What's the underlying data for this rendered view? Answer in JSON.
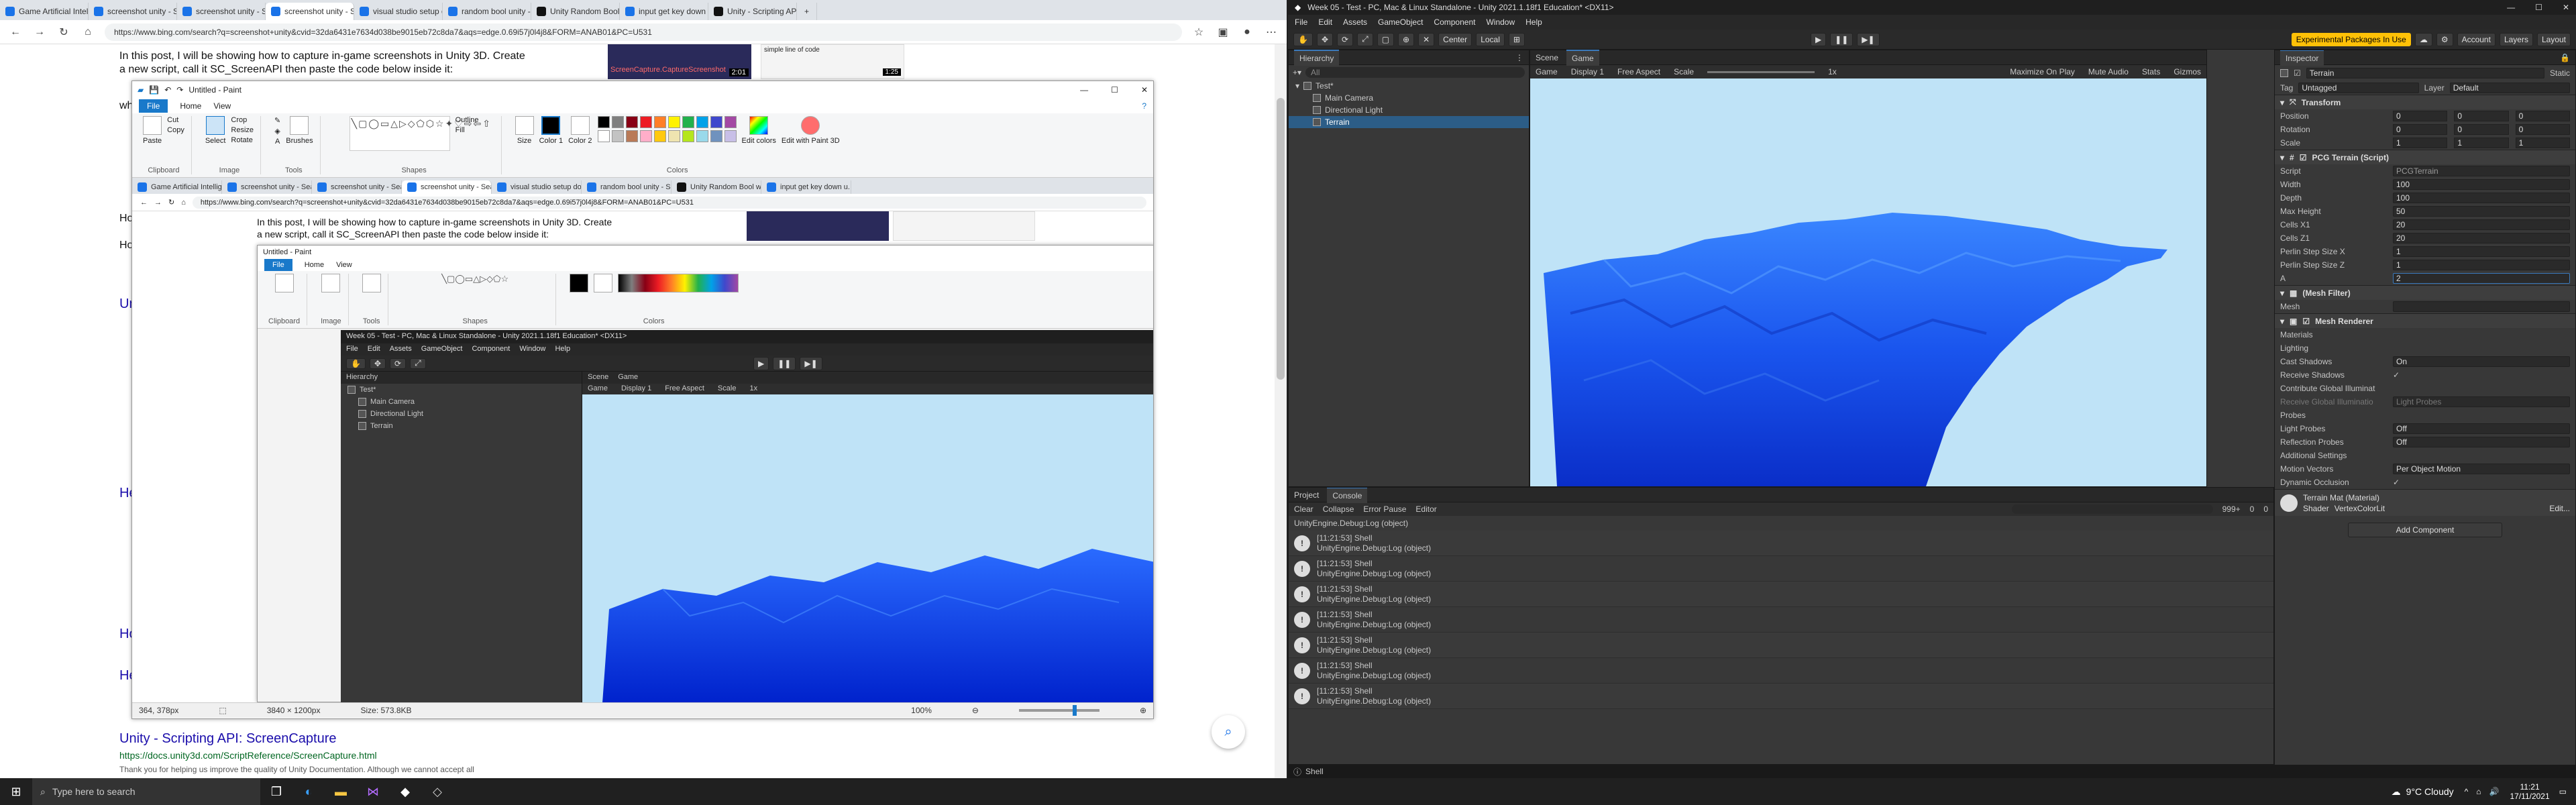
{
  "browser": {
    "tabs": [
      {
        "label": "Game Artificial Intellig..."
      },
      {
        "label": "screenshot unity - Sea..."
      },
      {
        "label": "screenshot unity - Sea..."
      },
      {
        "label": "screenshot unity - Sea..."
      },
      {
        "label": "visual studio setup do..."
      },
      {
        "label": "random bool unity - S..."
      },
      {
        "label": "Unity Random Bool w..."
      },
      {
        "label": "input get key down u..."
      },
      {
        "label": "Unity - Scripting API:..."
      }
    ],
    "url": "https://www.bing.com/search?q=screenshot+unity&cvid=32da6431e7634d038be9015eb72c8da7&aqs=edge.0.69i57j0l4j8&FORM=ANAB01&PC=U531",
    "page": {
      "intro_line1": "In this post, I will be showing how to capture in-game screenshots in Unity 3D. Create",
      "intro_line2": "a new script, call it SC_ScreenAPI then paste the code below inside it:",
      "result_title": "Unity - Scripting API: ScreenCapture",
      "result_url": "https://docs.unity3d.com/ScriptReference/ScreenCapture.html",
      "result_snippet": "Thank you for helping us improve the quality of Unity Documentation. Although we cannot accept all",
      "thumb1_text": "ScreenCapture.CaptureScreenshot",
      "thumb1_badge": "2:01",
      "thumb2_text": "simple line of code",
      "thumb2_badge": "1:25",
      "left_fragments": [
        "wh",
        "Ho",
        "Ho",
        "Wh",
        "Un",
        "He",
        "Ho",
        "He"
      ]
    }
  },
  "paint_outer": {
    "title": "Untitled - Paint",
    "menu": [
      "File",
      "Home",
      "View"
    ],
    "groups": [
      "Clipboard",
      "Image",
      "Tools",
      "Shapes",
      "Colors"
    ],
    "clipboard_items": [
      "Paste",
      "Cut",
      "Copy"
    ],
    "image_items": [
      "Select",
      "Crop",
      "Resize",
      "Rotate"
    ],
    "tool_items": [
      "Brushes"
    ],
    "shape_items": [
      "Outline",
      "Fill"
    ],
    "size_label": "Size",
    "color1_label": "Color 1",
    "color2_label": "Color 2",
    "edit_colors": "Edit colors",
    "edit_paint3d": "Edit with Paint 3D",
    "status_pos": "364, 378px",
    "status_dims": "3840 × 1200px",
    "status_size": "Size: 573.8KB",
    "zoom": "100%"
  },
  "nested": {
    "url": "https://www.bing.com/search?q=screenshot+unity&cvid=32da6431e7634d038be9015eb72c8da7&aqs=edge.0.69i57j0l4j8&FORM=ANAB01&PC=U531",
    "tabs": [
      "Game Artificial Intellig...",
      "screenshot unity - Sea...",
      "screenshot unity - Sea...",
      "screenshot unity - Sea...",
      "visual studio setup do...",
      "random bool unity - S...",
      "Unity Random Bool w...",
      "input get key down u..."
    ],
    "unity_title": "Week 05 - Test - PC, Mac & Linux Standalone - Unity 2021.1.18f1 Education* <DX11>",
    "unity_menu": [
      "File",
      "Edit",
      "Assets",
      "GameObject",
      "Component",
      "Window",
      "Help"
    ],
    "hier_items": [
      "Test*",
      "Main Camera",
      "Directional Light",
      "Terrain"
    ],
    "scene_tab": "Scene",
    "game_tab": "Game",
    "game_bar": [
      "Game",
      "Display 1",
      "Free Aspect",
      "Scale",
      "1x"
    ]
  },
  "unity": {
    "title": "Week 05 - Test - PC, Mac & Linux Standalone - Unity 2021.1.18f1 Education* <DX11>",
    "menu": [
      "File",
      "Edit",
      "Assets",
      "GameObject",
      "Component",
      "Window",
      "Help"
    ],
    "toolbar": {
      "pivot": "Center",
      "space": "Local",
      "experimental": "Experimental Packages In Use",
      "account": "Account",
      "layers": "Layers",
      "layout": "Layout"
    },
    "hierarchy": {
      "tab": "Hierarchy",
      "search_placeholder": "All",
      "items": [
        "Test*",
        "Main Camera",
        "Directional Light",
        "Terrain"
      ]
    },
    "scene_tabs": [
      "Scene",
      "Game"
    ],
    "game_bar": {
      "mode": "Game",
      "display": "Display 1",
      "aspect": "Free Aspect",
      "scale_label": "Scale",
      "scale_value": "1x",
      "toggles": [
        "Maximize On Play",
        "Mute Audio",
        "Stats",
        "Gizmos"
      ]
    },
    "inspector": {
      "tab": "Inspector",
      "object_name": "Terrain",
      "static_label": "Static",
      "tag_label": "Tag",
      "tag_value": "Untagged",
      "layer_label": "Layer",
      "layer_value": "Default",
      "transform": {
        "header": "Transform",
        "rows": [
          {
            "label": "Position",
            "x": "0",
            "y": "0",
            "z": "0"
          },
          {
            "label": "Rotation",
            "x": "0",
            "y": "0",
            "z": "0"
          },
          {
            "label": "Scale",
            "x": "1",
            "y": "1",
            "z": "1"
          }
        ]
      },
      "pcg": {
        "header": "PCG Terrain (Script)",
        "rows": [
          {
            "label": "Script",
            "value": "PCGTerrain"
          },
          {
            "label": "Width",
            "value": "100"
          },
          {
            "label": "Depth",
            "value": "100"
          },
          {
            "label": "Max Height",
            "value": "50"
          },
          {
            "label": "Cells X1",
            "value": "20"
          },
          {
            "label": "Cells Z1",
            "value": "20"
          },
          {
            "label": "Perlin Step Size X",
            "value": "1"
          },
          {
            "label": "Perlin Step Size Z",
            "value": "1"
          },
          {
            "label": "A",
            "value": "2"
          }
        ]
      },
      "mesh_filter": {
        "header": "(Mesh Filter)",
        "mesh_label": "Mesh",
        "mesh_value": ""
      },
      "mesh_renderer": {
        "header": "Mesh Renderer",
        "materials": "Materials",
        "lighting": "Lighting",
        "rows": [
          {
            "label": "Cast Shadows",
            "value": "On"
          },
          {
            "label": "Receive Shadows",
            "value": "✓"
          },
          {
            "label": "Contribute Global Illuminat",
            "value": ""
          },
          {
            "label": "Receive Global Illuminatio",
            "value": "Light Probes"
          }
        ],
        "probes": "Probes",
        "probe_rows": [
          {
            "label": "Light Probes",
            "value": "Off"
          },
          {
            "label": "Reflection Probes",
            "value": "Off"
          }
        ],
        "additional": "Additional Settings",
        "add_rows": [
          {
            "label": "Motion Vectors",
            "value": "Per Object Motion"
          },
          {
            "label": "Dynamic Occlusion",
            "value": "✓"
          }
        ]
      },
      "material": {
        "name": "Terrain Mat (Material)",
        "shader_label": "Shader",
        "shader_value": "VertexColorLit",
        "edit": "Edit..."
      },
      "add_component": "Add Component"
    },
    "console": {
      "tabs": [
        "Project",
        "Console"
      ],
      "buttons": [
        "Clear",
        "Collapse",
        "Error Pause",
        "Editor"
      ],
      "counts": [
        "999+",
        "0",
        "0"
      ],
      "entries": [
        {
          "time": "[11:21:53] Shell",
          "detail": "UnityEngine.Debug:Log (object)"
        },
        {
          "time": "[11:21:53] Shell",
          "detail": "UnityEngine.Debug:Log (object)"
        },
        {
          "time": "[11:21:53] Shell",
          "detail": "UnityEngine.Debug:Log (object)"
        },
        {
          "time": "[11:21:53] Shell",
          "detail": "UnityEngine.Debug:Log (object)"
        },
        {
          "time": "[11:21:53] Shell",
          "detail": "UnityEngine.Debug:Log (object)"
        },
        {
          "time": "[11:21:53] Shell",
          "detail": "UnityEngine.Debug:Log (object)"
        },
        {
          "time": "[11:21:53] Shell",
          "detail": "UnityEngine.Debug:Log (object)"
        }
      ],
      "first_detail": "UnityEngine.Debug:Log (object)",
      "status": "Shell"
    }
  },
  "taskbar": {
    "search_placeholder": "Type here to search",
    "weather": "9°C  Cloudy",
    "time": "11:21",
    "date": "17/11/2021"
  },
  "colors": {
    "sky": "#bfe3f7",
    "terrain_dark": "#0033cc",
    "terrain_light": "#2a7bff",
    "unity_bg": "#383838",
    "accent": "#1979ca"
  }
}
